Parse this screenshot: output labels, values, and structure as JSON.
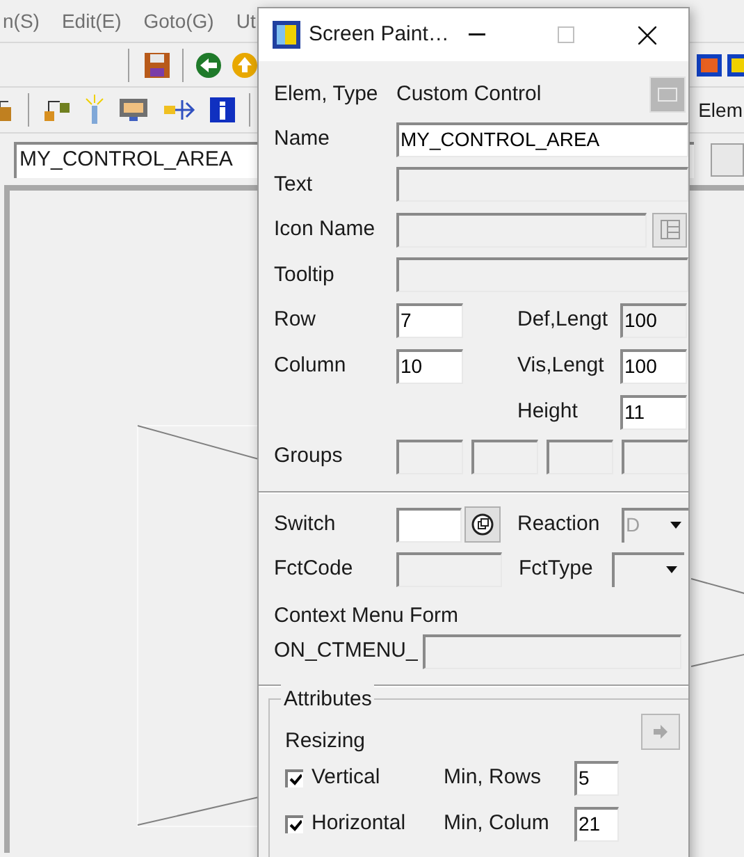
{
  "app": {
    "menu": [
      "n(S)",
      "Edit(E)",
      "Goto(G)",
      "Ut"
    ],
    "name_field": {
      "value": "MY_CONTROL_AREA"
    },
    "side_label": "Elem"
  },
  "dialog": {
    "title": "Screen Paint…",
    "elem_type": {
      "label": "Elem, Type",
      "value": "Custom Control"
    },
    "fields": [
      {
        "label": "Name",
        "value": "MY_CONTROL_AREA",
        "disabled": false
      },
      {
        "label": "Text",
        "disabled": true
      },
      {
        "label": "Icon Name",
        "disabled": true
      },
      {
        "label": "Tooltip",
        "disabled": true
      }
    ],
    "row": {
      "label": "Row",
      "value": "7",
      "disabled": false
    },
    "column": {
      "label": "Column",
      "value": "10",
      "disabled": false
    },
    "def_length": {
      "label": "Def,Lengt",
      "value": "100",
      "disabled": true
    },
    "vis_length": {
      "label": "Vis,Lengt",
      "value": "100",
      "disabled": false
    },
    "height": {
      "label": "Height",
      "value": "11",
      "disabled": false
    },
    "groups": {
      "label": "Groups",
      "boxes": [
        {
          "disabled": true
        },
        {
          "disabled": true
        },
        {
          "disabled": true
        },
        {
          "disabled": true
        }
      ]
    },
    "switch": {
      "label": "Switch",
      "disabled": false
    },
    "reaction": {
      "label": "Reaction",
      "value": "D",
      "disabled": true
    },
    "fct_code": {
      "label": "FctCode",
      "disabled": true
    },
    "fct_type": {
      "label": "FctType",
      "disabled": true
    },
    "context_menu": {
      "label": "Context Menu Form",
      "prefix": "ON_CTMENU_",
      "disabled": true
    },
    "attributes": {
      "title": "Attributes",
      "resizing": "Resizing",
      "options": [
        {
          "label": "Vertical",
          "checked": true,
          "min_label": "Min, Rows",
          "min_value": "5"
        },
        {
          "label": "Horizontal",
          "checked": true,
          "min_label": "Min, Colum",
          "min_value": "21"
        }
      ]
    }
  }
}
